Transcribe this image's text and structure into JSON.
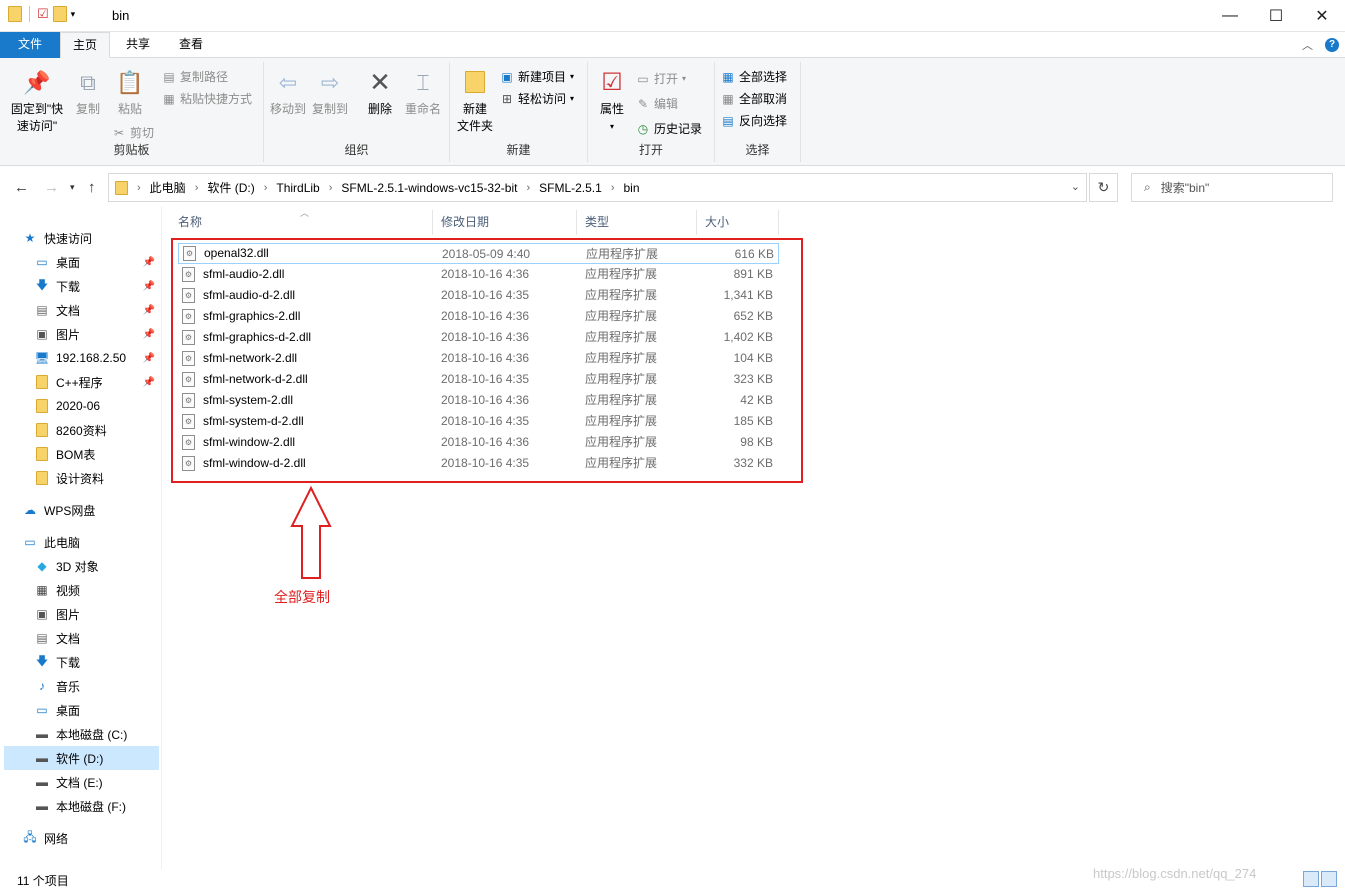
{
  "window": {
    "title": "bin",
    "minimize": "—",
    "maximize": "☐",
    "close": "✕"
  },
  "tabs": {
    "file": "文件",
    "home": "主页",
    "share": "共享",
    "view": "查看"
  },
  "ribbon": {
    "clipboard": {
      "label": "剪贴板",
      "pin_line1": "固定到\"快",
      "pin_line2": "速访问\"",
      "copy": "复制",
      "paste": "粘贴",
      "copy_path": "复制路径",
      "paste_shortcut": "粘贴快捷方式",
      "cut": "剪切"
    },
    "organize": {
      "label": "组织",
      "move_to": "移动到",
      "copy_to": "复制到",
      "delete": "删除",
      "rename": "重命名"
    },
    "new": {
      "label": "新建",
      "new_folder_line1": "新建",
      "new_folder_line2": "文件夹",
      "new_item": "新建项目",
      "easy_access": "轻松访问"
    },
    "open": {
      "label": "打开",
      "properties": "属性",
      "open": "打开",
      "edit": "编辑",
      "history": "历史记录"
    },
    "select": {
      "label": "选择",
      "select_all": "全部选择",
      "select_none": "全部取消",
      "invert": "反向选择"
    }
  },
  "address": {
    "crumbs": [
      "此电脑",
      "软件 (D:)",
      "ThirdLib",
      "SFML-2.5.1-windows-vc15-32-bit",
      "SFML-2.5.1",
      "bin"
    ],
    "search_placeholder": "搜索\"bin\""
  },
  "nav": {
    "quick_access": "快速访问",
    "quick": [
      "桌面",
      "下载",
      "文档",
      "图片",
      "192.168.2.50",
      "C++程序",
      "2020-06",
      "8260资料",
      "BOM表",
      "设计资料"
    ],
    "wps": "WPS网盘",
    "this_pc": "此电脑",
    "pc": [
      "3D 对象",
      "视频",
      "图片",
      "文档",
      "下载",
      "音乐",
      "桌面",
      "本地磁盘 (C:)",
      "软件 (D:)",
      "文档 (E:)",
      "本地磁盘 (F:)"
    ],
    "network": "网络"
  },
  "columns": {
    "name": "名称",
    "date": "修改日期",
    "type": "类型",
    "size": "大小"
  },
  "files": [
    {
      "name": "openal32.dll",
      "date": "2018-05-09 4:40",
      "type": "应用程序扩展",
      "size": "616 KB"
    },
    {
      "name": "sfml-audio-2.dll",
      "date": "2018-10-16 4:36",
      "type": "应用程序扩展",
      "size": "891 KB"
    },
    {
      "name": "sfml-audio-d-2.dll",
      "date": "2018-10-16 4:35",
      "type": "应用程序扩展",
      "size": "1,341 KB"
    },
    {
      "name": "sfml-graphics-2.dll",
      "date": "2018-10-16 4:36",
      "type": "应用程序扩展",
      "size": "652 KB"
    },
    {
      "name": "sfml-graphics-d-2.dll",
      "date": "2018-10-16 4:36",
      "type": "应用程序扩展",
      "size": "1,402 KB"
    },
    {
      "name": "sfml-network-2.dll",
      "date": "2018-10-16 4:36",
      "type": "应用程序扩展",
      "size": "104 KB"
    },
    {
      "name": "sfml-network-d-2.dll",
      "date": "2018-10-16 4:35",
      "type": "应用程序扩展",
      "size": "323 KB"
    },
    {
      "name": "sfml-system-2.dll",
      "date": "2018-10-16 4:36",
      "type": "应用程序扩展",
      "size": "42 KB"
    },
    {
      "name": "sfml-system-d-2.dll",
      "date": "2018-10-16 4:35",
      "type": "应用程序扩展",
      "size": "185 KB"
    },
    {
      "name": "sfml-window-2.dll",
      "date": "2018-10-16 4:36",
      "type": "应用程序扩展",
      "size": "98 KB"
    },
    {
      "name": "sfml-window-d-2.dll",
      "date": "2018-10-16 4:35",
      "type": "应用程序扩展",
      "size": "332 KB"
    }
  ],
  "annotation": "全部复制",
  "status": {
    "count": "11 个项目"
  },
  "watermark": "https://blog.csdn.net/qq_274",
  "colors": {
    "accent": "#1979ca",
    "annotation": "#e02020",
    "selection": "#cce8ff"
  }
}
